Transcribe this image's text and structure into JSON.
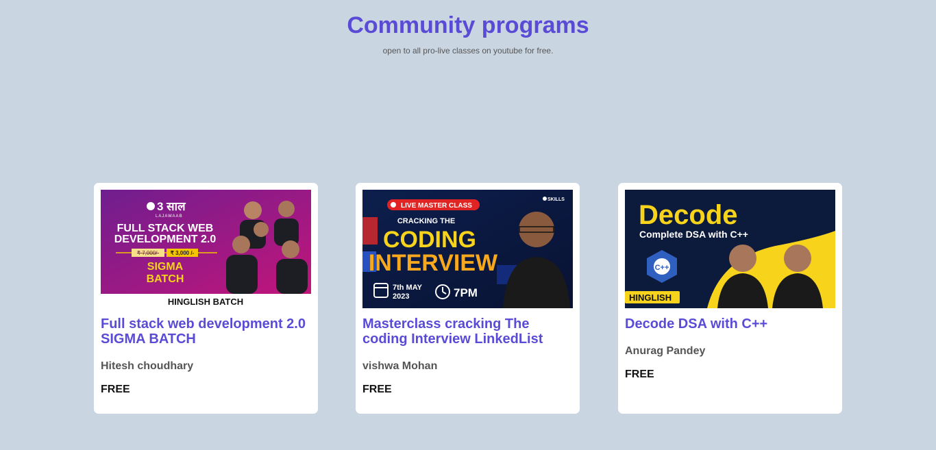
{
  "header": {
    "title": "Community programs",
    "subtitle": "open to all pro-live classes on youtube for free."
  },
  "cards": [
    {
      "title": "Full stack web development 2.0 SIGMA BATCH",
      "author": "Hitesh choudhary",
      "price": "FREE",
      "thumb": {
        "badge": "3 साल",
        "badge_sub": "LAJAWAAB",
        "line1": "FULL STACK WEB",
        "line2": "DEVELOPMENT 2.0",
        "old_price": "₹ 7,000/-",
        "new_price": "₹ 3,000 /-",
        "batch1": "SIGMA",
        "batch2": "BATCH",
        "footer": "HINGLISH BATCH"
      }
    },
    {
      "title": "Masterclass cracking The coding Interview LinkedList",
      "author": "vishwa Mohan",
      "price": "FREE",
      "thumb": {
        "live": "LIVE MASTER CLASS",
        "brand": "SKILLS",
        "pre": "CRACKING THE",
        "line1": "CODING",
        "line2": "INTERVIEW",
        "date": "7th MAY",
        "year": "2023",
        "time": "7PM"
      }
    },
    {
      "title": "Decode DSA with C++",
      "author": "Anurag Pandey",
      "price": "FREE",
      "thumb": {
        "line1": "Decode",
        "line2": "Complete DSA with C++",
        "logo": "C++",
        "lang": "HINGLISH"
      }
    }
  ],
  "colors": {
    "background": "#c9d5e1",
    "accent": "#5a4bd6"
  }
}
